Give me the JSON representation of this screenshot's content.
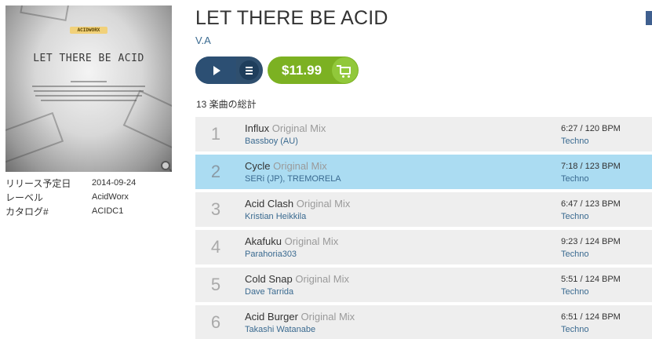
{
  "artwork": {
    "logo_text": "ACIDWORX",
    "title": "LET THERE BE ACID"
  },
  "meta": [
    {
      "label": "リリース予定日",
      "value": "2014-09-24"
    },
    {
      "label": "レーベル",
      "value": "AcidWorx"
    },
    {
      "label": "カタログ#",
      "value": "ACIDC1"
    }
  ],
  "release": {
    "title": "LET THERE BE ACID",
    "artist": "V.A",
    "price": "$11.99",
    "track_count_label": "13 楽曲の総計"
  },
  "colors": {
    "player": "#2c4f73",
    "price": "#7cb122",
    "selected_row": "#abdcf2",
    "row": "#eeeeee",
    "link": "#3a6a90"
  },
  "icons": {
    "play": "play-icon",
    "menu": "menu-icon",
    "cart": "cart-icon",
    "zoom": "zoom-icon"
  },
  "tracks": [
    {
      "num": "1",
      "title": "Influx",
      "mix": "Original Mix",
      "artist": "Bassboy (AU)",
      "bpm": "6:27 / 120 BPM",
      "genre": "Techno",
      "selected": false
    },
    {
      "num": "2",
      "title": "Cycle",
      "mix": "Original Mix",
      "artist": "SERi (JP), TREMORELA",
      "bpm": "7:18 / 123 BPM",
      "genre": "Techno",
      "selected": true
    },
    {
      "num": "3",
      "title": "Acid Clash",
      "mix": "Original Mix",
      "artist": "Kristian Heikkila",
      "bpm": "6:47 / 123 BPM",
      "genre": "Techno",
      "selected": false
    },
    {
      "num": "4",
      "title": "Akafuku",
      "mix": "Original Mix",
      "artist": "Parahoria303",
      "bpm": "9:23 / 124 BPM",
      "genre": "Techno",
      "selected": false
    },
    {
      "num": "5",
      "title": "Cold Snap",
      "mix": "Original Mix",
      "artist": "Dave Tarrida",
      "bpm": "5:51 / 124 BPM",
      "genre": "Techno",
      "selected": false
    },
    {
      "num": "6",
      "title": "Acid Burger",
      "mix": "Original Mix",
      "artist": "Takashi Watanabe",
      "bpm": "6:51 / 124 BPM",
      "genre": "Techno",
      "selected": false
    }
  ]
}
